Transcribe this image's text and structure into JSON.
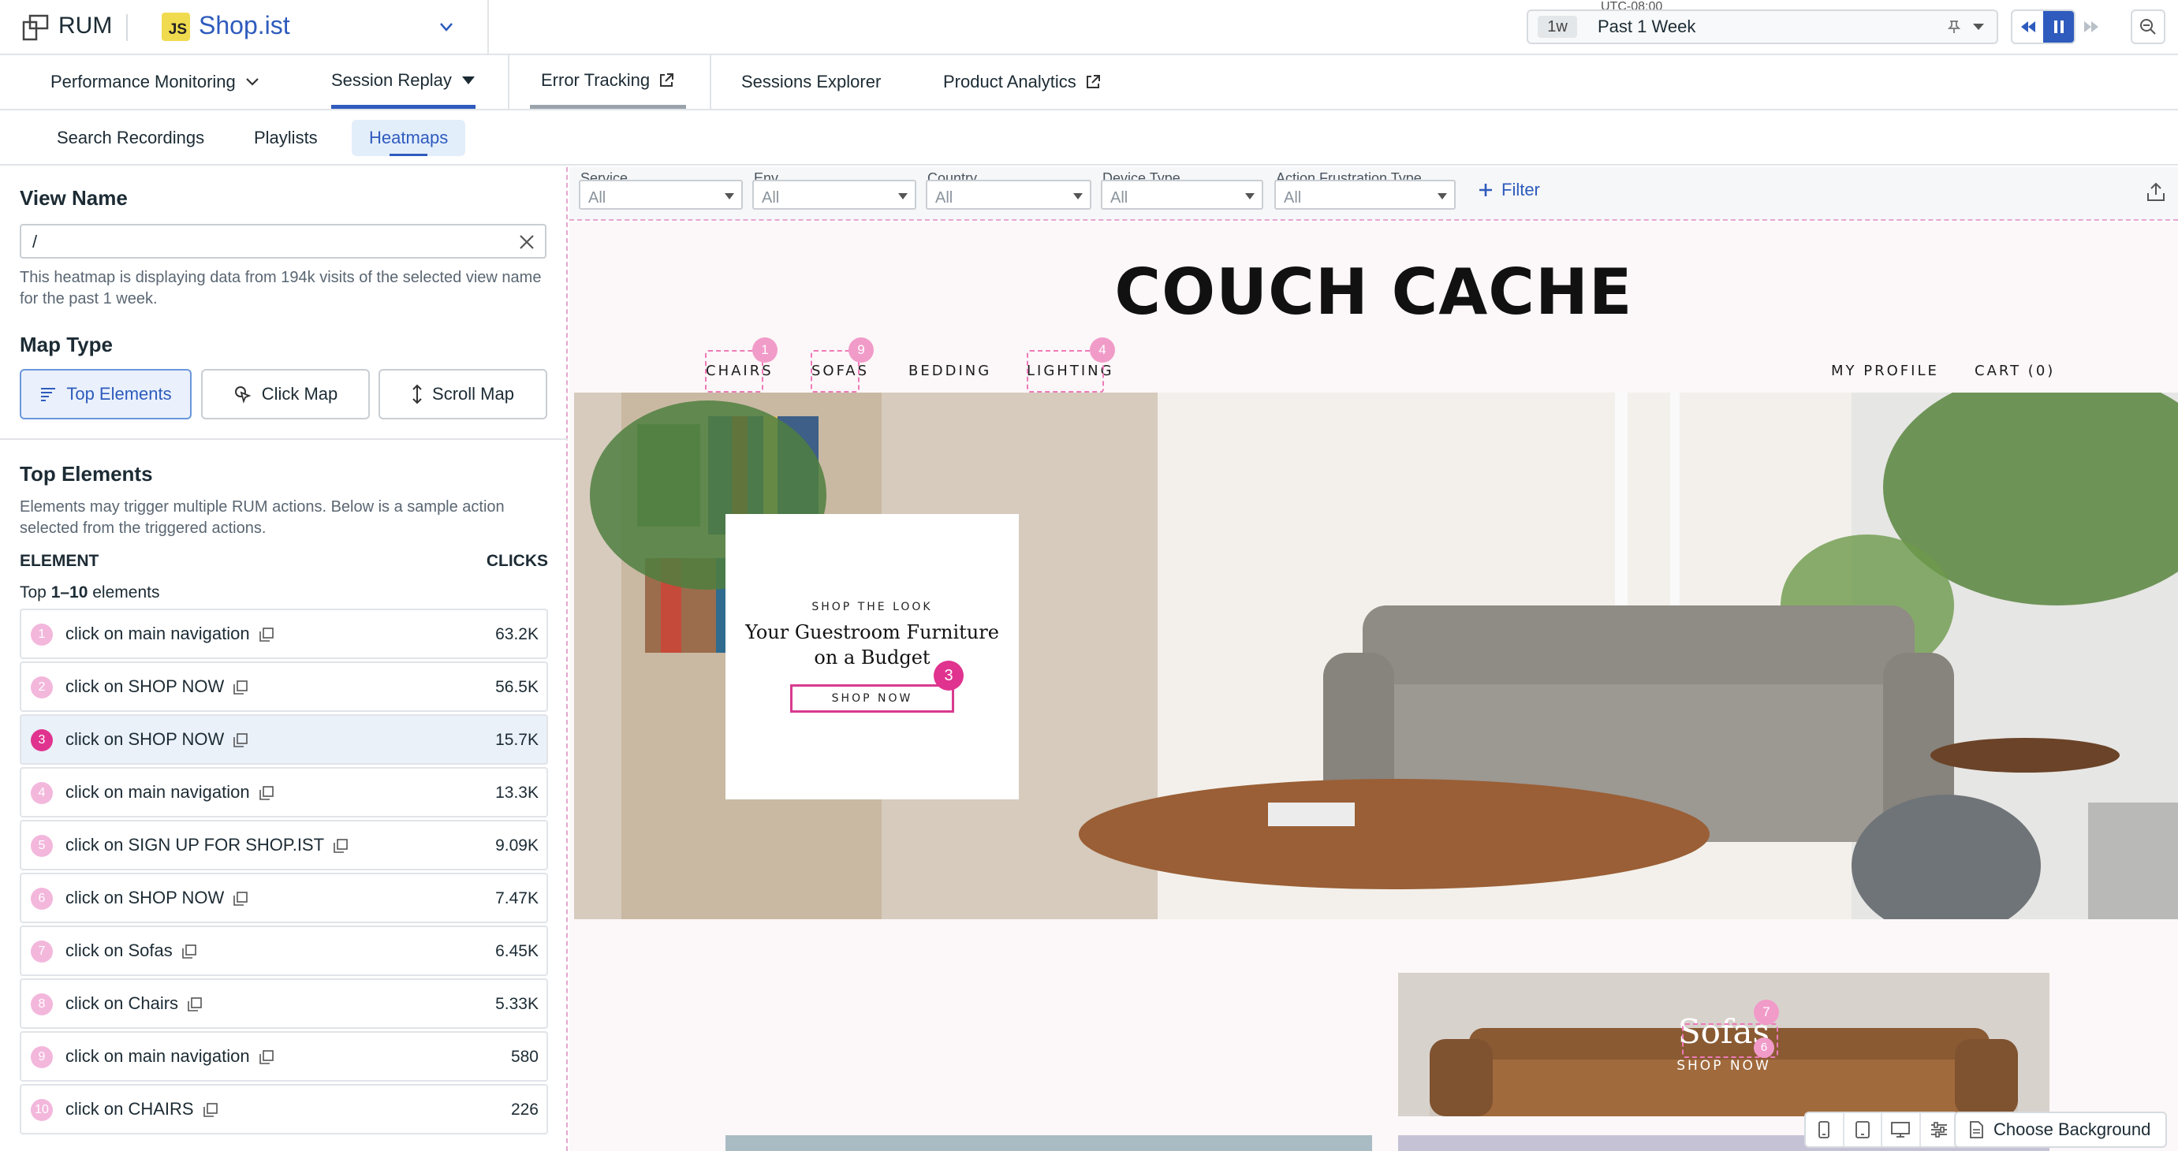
{
  "topbar": {
    "product": "RUM",
    "app_badge": "JS",
    "app_name": "Shop.ist",
    "timezone": "UTC-08:00",
    "time_chip": "1w",
    "time_range": "Past 1 Week"
  },
  "main_nav": {
    "items": [
      {
        "label": "Performance Monitoring",
        "icon": "chevron-down-icon"
      },
      {
        "label": "Session Replay",
        "icon": "caret-down-icon",
        "active": true
      },
      {
        "label": "Error Tracking",
        "icon": "external-link-icon"
      },
      {
        "label": "Sessions Explorer"
      },
      {
        "label": "Product Analytics",
        "icon": "external-link-icon"
      }
    ]
  },
  "sub_nav": {
    "items": [
      {
        "label": "Search Recordings"
      },
      {
        "label": "Playlists"
      },
      {
        "label": "Heatmaps",
        "active": true
      }
    ]
  },
  "left_panel": {
    "view_name_heading": "View Name",
    "view_name_value": "/",
    "description": "This heatmap is displaying data from 194k visits of the selected view name for the past 1 week.",
    "map_type_heading": "Map Type",
    "map_types": [
      {
        "label": "Top Elements",
        "icon": "list-icon",
        "active": true
      },
      {
        "label": "Click Map",
        "icon": "cursor-click-icon"
      },
      {
        "label": "Scroll Map",
        "icon": "vertical-arrows-icon"
      }
    ],
    "top_elements_heading": "Top Elements",
    "top_elements_desc": "Elements may trigger multiple RUM actions. Below is a sample action selected from the triggered actions.",
    "col_element": "ELEMENT",
    "col_clicks": "CLICKS",
    "range_prefix": "Top ",
    "range_value": "1–10",
    "range_suffix": " elements",
    "elements": [
      {
        "rank": "1",
        "label": "click on main navigation",
        "clicks": "63.2K"
      },
      {
        "rank": "2",
        "label": "click on SHOP NOW",
        "clicks": "56.5K"
      },
      {
        "rank": "3",
        "label": "click on SHOP NOW",
        "clicks": "15.7K",
        "selected": true
      },
      {
        "rank": "4",
        "label": "click on main navigation",
        "clicks": "13.3K"
      },
      {
        "rank": "5",
        "label": "click on SIGN UP FOR SHOP.IST",
        "clicks": "9.09K"
      },
      {
        "rank": "6",
        "label": "click on SHOP NOW",
        "clicks": "7.47K"
      },
      {
        "rank": "7",
        "label": "click on Sofas",
        "clicks": "6.45K"
      },
      {
        "rank": "8",
        "label": "click on Chairs",
        "clicks": "5.33K"
      },
      {
        "rank": "9",
        "label": "click on main navigation",
        "clicks": "580"
      },
      {
        "rank": "10",
        "label": "click on CHAIRS",
        "clicks": "226"
      }
    ]
  },
  "filters": {
    "items": [
      {
        "label": "Service",
        "value": "All"
      },
      {
        "label": "Env",
        "value": "All"
      },
      {
        "label": "Country",
        "value": "All"
      },
      {
        "label": "Device Type",
        "value": "All"
      },
      {
        "label": "Action Frustration Type",
        "value": "All"
      }
    ],
    "add_filter": "Filter"
  },
  "site": {
    "logo": "COUCH CACHE",
    "nav": [
      "CHAIRS",
      "SOFAS",
      "BEDDING",
      "LIGHTING"
    ],
    "nav_right": [
      "MY PROFILE",
      "CART (0)"
    ],
    "hero_eyebrow": "SHOP THE LOOK",
    "hero_title": "Your Guestroom Furniture on a Budget",
    "hero_button": "SHOP NOW",
    "sofa_title": "Sofas",
    "sofa_button": "SHOP NOW",
    "pins": {
      "chairs": "1",
      "sofas": "9",
      "lighting": "4",
      "shop_now": "3",
      "sofa_title": "7",
      "sofa_button": "6"
    }
  },
  "bottom": {
    "choose_background": "Choose Background"
  },
  "colors": {
    "accent": "#2e5bbd",
    "heat_pin": "#f19bc9",
    "heat_pin_strong": "#e0338f",
    "heat_outline": "#ee7ab9"
  }
}
